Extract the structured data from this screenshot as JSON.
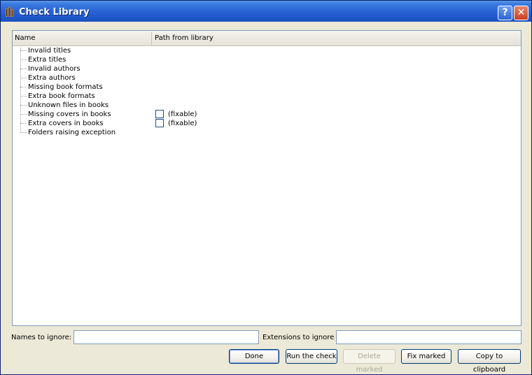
{
  "window": {
    "title": "Check Library",
    "help_glyph": "?",
    "close_glyph": "✕",
    "icon": "books-icon"
  },
  "tree": {
    "columns": {
      "name": "Name",
      "path": "Path from library"
    },
    "items": [
      {
        "label": "Invalid titles",
        "fixable": false
      },
      {
        "label": "Extra titles",
        "fixable": false
      },
      {
        "label": "Invalid authors",
        "fixable": false
      },
      {
        "label": "Extra authors",
        "fixable": false
      },
      {
        "label": "Missing book formats",
        "fixable": false
      },
      {
        "label": "Extra book formats",
        "fixable": false
      },
      {
        "label": "Unknown files in books",
        "fixable": false
      },
      {
        "label": "Missing covers in books",
        "fixable": true,
        "fix_label": "(fixable)",
        "checked": false
      },
      {
        "label": "Extra covers in books",
        "fixable": true,
        "fix_label": "(fixable)",
        "checked": false
      },
      {
        "label": "Folders raising exception",
        "fixable": false
      }
    ]
  },
  "filters": {
    "names_label": "Names to ignore:",
    "names_value": "",
    "extensions_label": "Extensions to ignore",
    "extensions_value": ""
  },
  "buttons": {
    "done": "Done",
    "run": "Run the check",
    "delete": "Delete marked",
    "fix": "Fix marked",
    "copy": "Copy to clipboard"
  }
}
